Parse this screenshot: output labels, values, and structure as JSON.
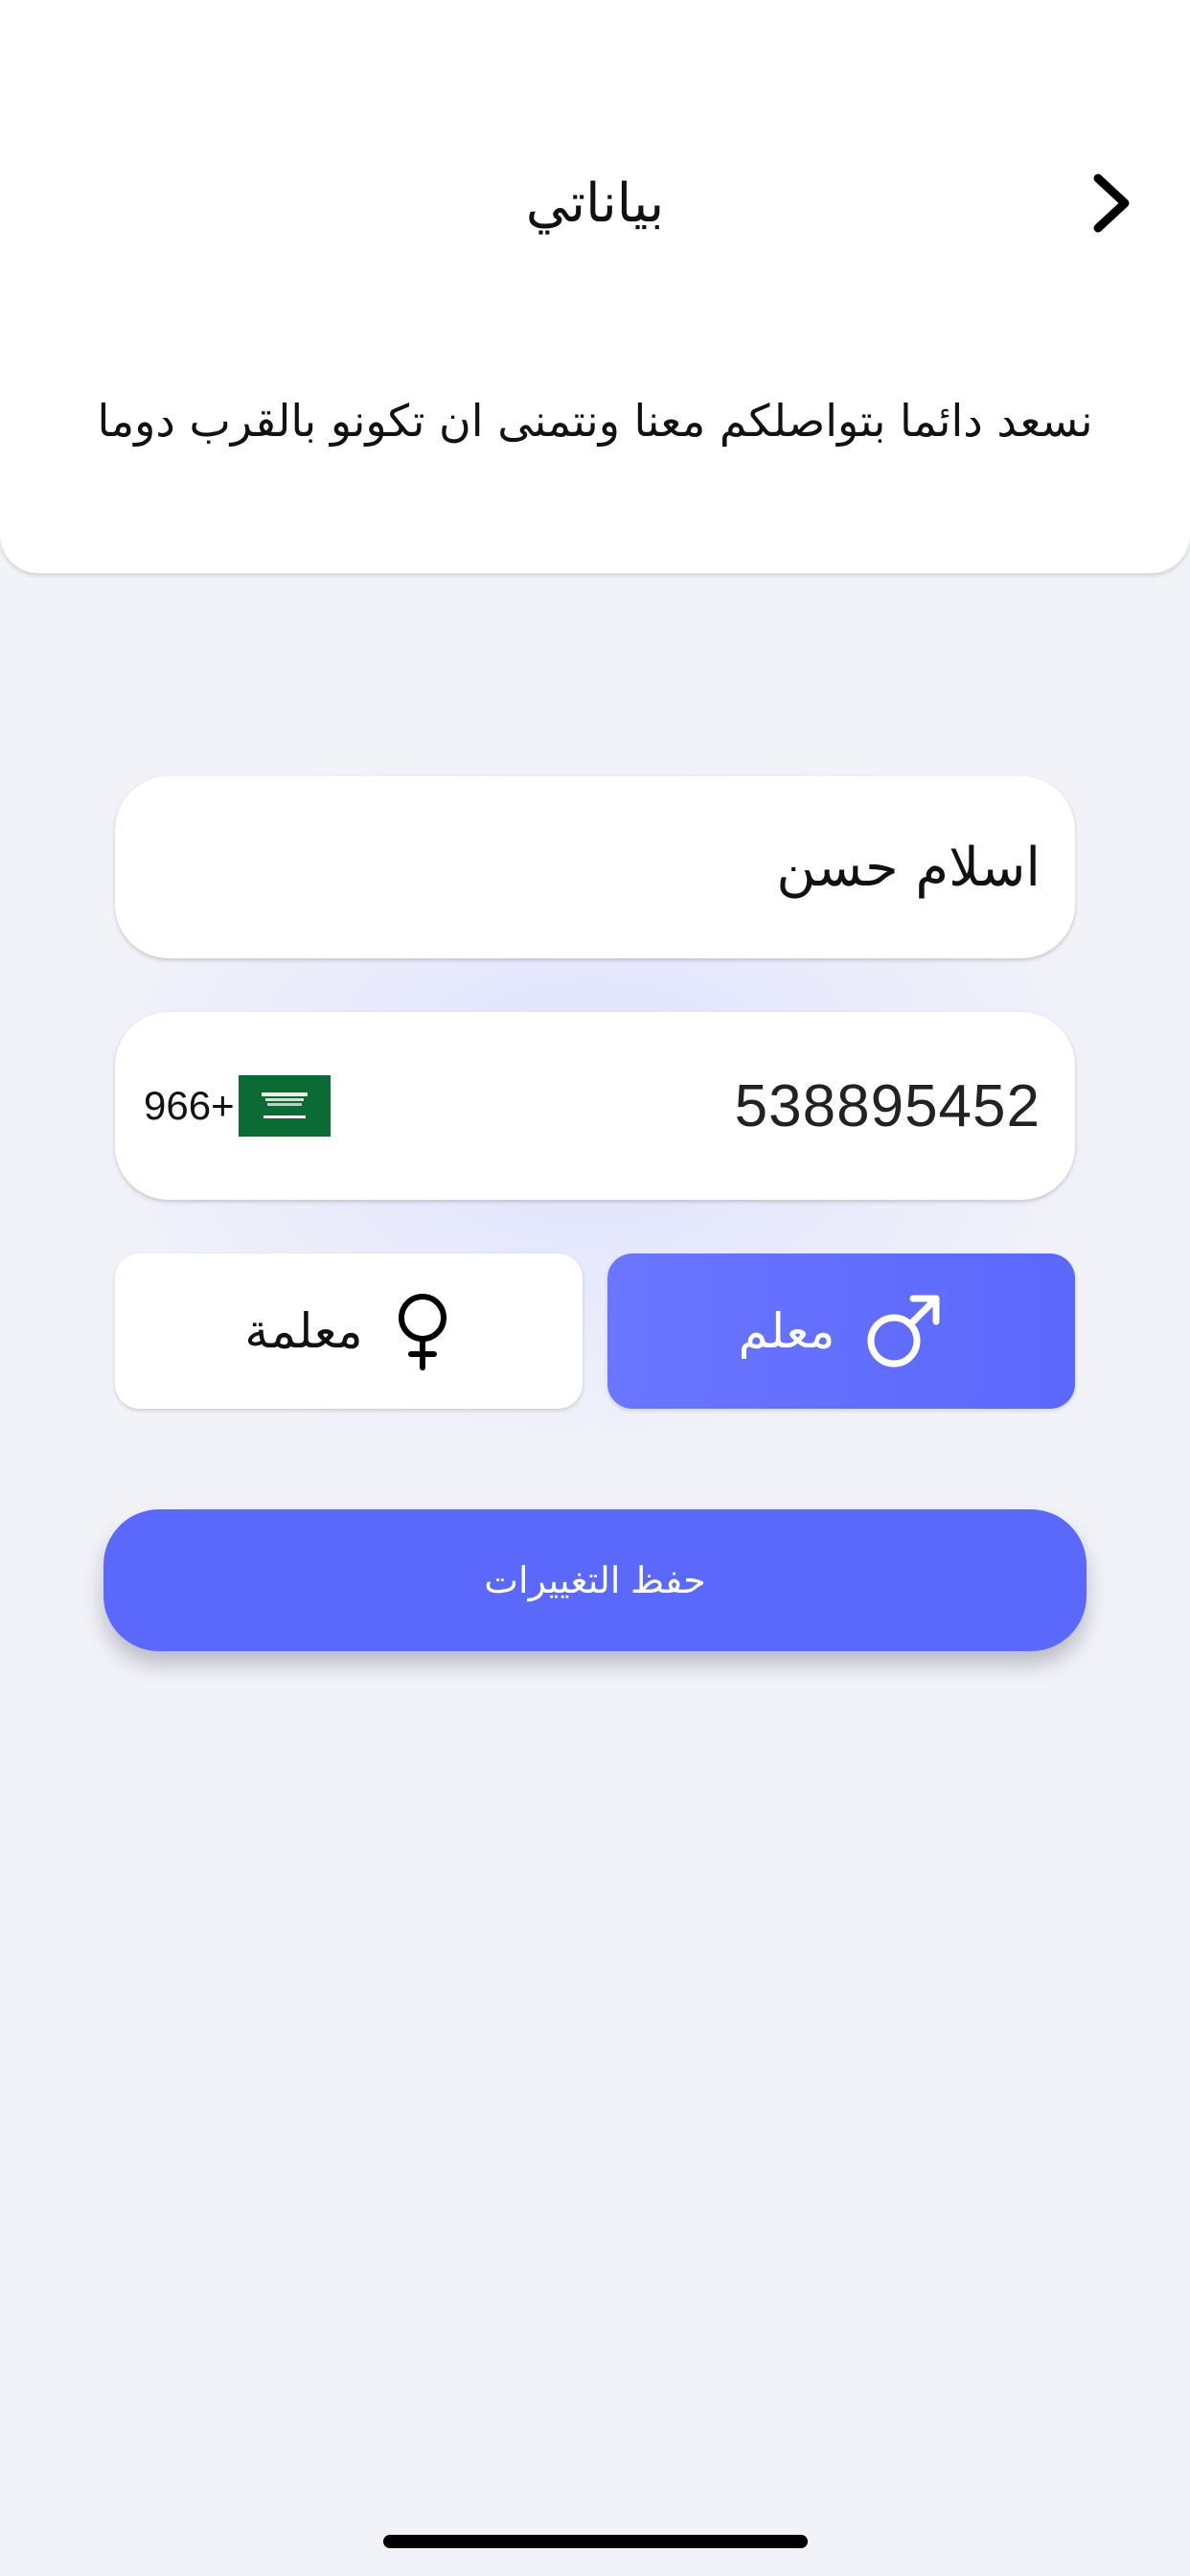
{
  "header": {
    "title": "بياناتي",
    "subtitle": "نسعد دائما بتواصلكم معنا ونتمنى ان تكونو بالقرب دوما",
    "back_icon": "chevron-right-icon"
  },
  "form": {
    "name": {
      "value": "اسلام حسن"
    },
    "phone": {
      "value": "538895452",
      "dial_code": "966+",
      "flag_icon": "saudi-flag-icon"
    },
    "gender": {
      "options": [
        {
          "label": "معلم",
          "icon": "male-icon",
          "selected": true
        },
        {
          "label": "معلمة",
          "icon": "female-icon",
          "selected": false
        }
      ]
    },
    "save_label": "حفظ التغييرات"
  },
  "colors": {
    "accent": "#5a68fb",
    "background": "#f2f3f8",
    "card": "#ffffff",
    "flag_green": "#0b6b34"
  }
}
